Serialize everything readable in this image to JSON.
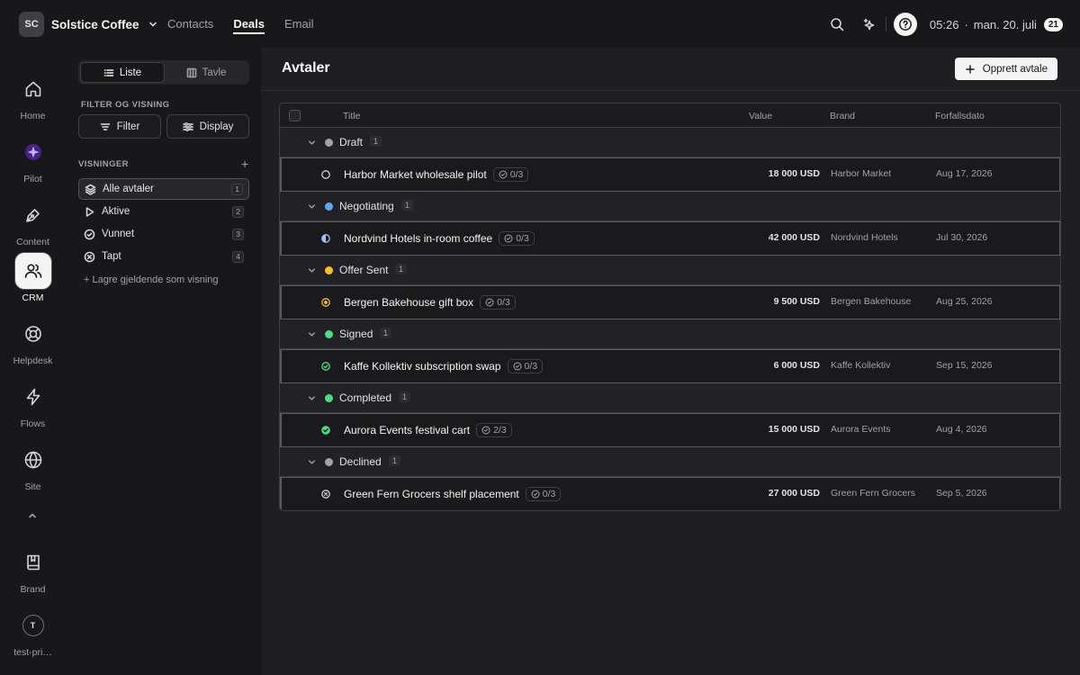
{
  "org": {
    "initials": "SC",
    "name": "Solstice Coffee"
  },
  "topnav": [
    {
      "label": "Contacts",
      "active": false
    },
    {
      "label": "Deals",
      "active": true
    },
    {
      "label": "Email",
      "active": false
    }
  ],
  "topbar": {
    "time": "05:26",
    "separator": "·",
    "date": "man. 20. juli",
    "day_badge": "21"
  },
  "rail": {
    "items": [
      {
        "label": "Home",
        "icon": "home-icon"
      },
      {
        "label": "Pilot",
        "icon": "pilot-icon"
      },
      {
        "label": "Content",
        "icon": "pen-icon"
      },
      {
        "label": "CRM",
        "icon": "users-icon",
        "active": true
      },
      {
        "label": "Helpdesk",
        "icon": "lifebuoy-icon"
      },
      {
        "label": "Flows",
        "icon": "lightning-icon"
      },
      {
        "label": "Site",
        "icon": "globe-icon"
      }
    ],
    "brand_label": "Brand",
    "user_initial": "T",
    "user_label": "test-pri…"
  },
  "sidebar": {
    "view_modes": [
      {
        "label": "Liste",
        "active": true
      },
      {
        "label": "Tavle",
        "active": false
      }
    ],
    "filter_heading": "FILTER OG VISNING",
    "filter_label": "Filter",
    "display_label": "Display",
    "views_heading": "VISNINGER",
    "add_view": "+",
    "views": [
      {
        "label": "Alle avtaler",
        "count": "1",
        "icon": "layers-icon",
        "active": true
      },
      {
        "label": "Aktive",
        "count": "2",
        "icon": "play-icon"
      },
      {
        "label": "Vunnet",
        "count": "3",
        "icon": "check-circle-icon"
      },
      {
        "label": "Tapt",
        "count": "4",
        "icon": "x-circle-icon"
      }
    ],
    "save_view": "+ Lagre gjeldende som visning"
  },
  "main": {
    "title": "Avtaler",
    "create_label": "Opprett avtale",
    "columns": {
      "title": "Title",
      "value": "Value",
      "brand": "Brand",
      "due": "Forfallsdato"
    },
    "groups": [
      {
        "name": "Draft",
        "count": "1",
        "color": "#a1a1aa",
        "deal": {
          "title": "Harbor Market wholesale pilot",
          "tasks": "0/3",
          "value": "18 000 USD",
          "brand": "Harbor Market",
          "due": "Aug 17, 2026",
          "status": "draft"
        }
      },
      {
        "name": "Negotiating",
        "count": "1",
        "color": "#60a5fa",
        "deal": {
          "title": "Nordvind Hotels in-room coffee",
          "tasks": "0/3",
          "value": "42 000 USD",
          "brand": "Nordvind Hotels",
          "due": "Jul 30, 2026",
          "status": "negotiating"
        }
      },
      {
        "name": "Offer Sent",
        "count": "1",
        "color": "#fbbf24",
        "deal": {
          "title": "Bergen Bakehouse gift box",
          "tasks": "0/3",
          "value": "9 500 USD",
          "brand": "Bergen Bakehouse",
          "due": "Aug 25, 2026",
          "status": "offer"
        }
      },
      {
        "name": "Signed",
        "count": "1",
        "color": "#4ade80",
        "deal": {
          "title": "Kaffe Kollektiv subscription swap",
          "tasks": "0/3",
          "value": "6 000 USD",
          "brand": "Kaffe Kollektiv",
          "due": "Sep 15, 2026",
          "status": "signed"
        }
      },
      {
        "name": "Completed",
        "count": "1",
        "color": "#4ade80",
        "deal": {
          "title": "Aurora Events festival cart",
          "tasks": "2/3",
          "value": "15 000 USD",
          "brand": "Aurora Events",
          "due": "Aug 4, 2026",
          "status": "completed"
        }
      },
      {
        "name": "Declined",
        "count": "1",
        "color": "#a1a1aa",
        "deal": {
          "title": "Green Fern Grocers shelf placement",
          "tasks": "0/3",
          "value": "27 000 USD",
          "brand": "Green Fern Grocers",
          "due": "Sep 5, 2026",
          "status": "declined"
        }
      }
    ]
  }
}
